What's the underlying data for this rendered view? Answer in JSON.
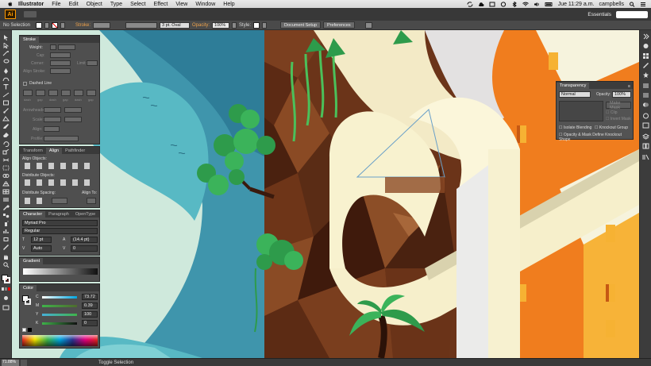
{
  "menubar": {
    "app_name": "Illustrator",
    "items": [
      "File",
      "Edit",
      "Object",
      "Type",
      "Select",
      "Effect",
      "View",
      "Window",
      "Help"
    ],
    "clock": "Jue 11:29 a.m.",
    "user": "campbells"
  },
  "appbar": {
    "workspace": "Essentials"
  },
  "control": {
    "selection": "No Selection",
    "stroke_label": "Stroke:",
    "brush": "3 pt. Oval",
    "opacity_label": "Opacity:",
    "opacity_value": "100%",
    "style_label": "Style:",
    "document_setup": "Document Setup",
    "preferences": "Preferences"
  },
  "stroke_panel": {
    "title": "Stroke",
    "weight": "Weight:",
    "cap": "Cap:",
    "corner": "Corner:",
    "limit": "Limit:",
    "align_stroke": "Align Stroke:",
    "dashed_line": "Dashed Line",
    "dash_labels": [
      "dash",
      "gap",
      "dash",
      "gap",
      "dash",
      "gap"
    ],
    "arrowheads": "Arrowheads:",
    "scale": "Scale:",
    "align": "Align:",
    "profile": "Profile:"
  },
  "align_panel": {
    "tabs": [
      "Transform",
      "Align",
      "Pathfinder"
    ],
    "align_objects": "Align Objects:",
    "distribute_objects": "Distribute Objects:",
    "distribute_spacing": "Distribute Spacing:",
    "align_to": "Align To:"
  },
  "character_panel": {
    "tabs": [
      "Character",
      "Paragraph",
      "OpenType"
    ],
    "font": "Myriad Pro",
    "style": "Regular",
    "size": "12 pt",
    "leading": "(14.4 pt)",
    "kerning": "Auto",
    "tracking": "0"
  },
  "gradient_panel": {
    "title": "Gradient"
  },
  "color_panel": {
    "title": "Color",
    "channels": [
      {
        "label": "C",
        "value": "73.72"
      },
      {
        "label": "M",
        "value": "0.39"
      },
      {
        "label": "Y",
        "value": "100"
      },
      {
        "label": "K",
        "value": "0"
      }
    ]
  },
  "transparency_panel": {
    "title": "Transparency",
    "mode": "Normal",
    "opacity_label": "Opacity:",
    "opacity": "100%",
    "make_mask": "Make Mask",
    "clip": "Clip",
    "invert_mask": "Invert Mask",
    "isolate_blending": "Isolate Blending",
    "knockout_group": "Knockout Group",
    "opacity_mask_define": "Opacity & Mask Define Knockout Shape"
  },
  "status": {
    "zoom": "71.88%",
    "tool": "Toggle Selection"
  },
  "colors": {
    "accent_orange": "#f07d1e",
    "panel_bg": "#4f4f4f",
    "canvas_cream": "#f6f3dd"
  }
}
